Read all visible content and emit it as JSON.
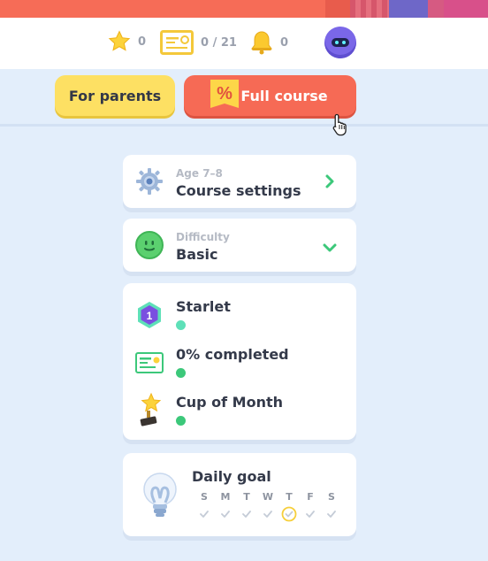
{
  "stats": {
    "stars": "0",
    "certificates": "0 / 21",
    "notifications": "0"
  },
  "nav": {
    "parents_label": "For parents",
    "full_course_label": "Full course",
    "full_course_badge": "%"
  },
  "course_settings": {
    "sub": "Age 7–8",
    "title": "Course settings"
  },
  "difficulty": {
    "sub": "Difficulty",
    "value": "Basic"
  },
  "progress": {
    "items": [
      {
        "label": "Starlet",
        "badge": "1",
        "status_color": "#5ee0b8"
      },
      {
        "label": "0% completed",
        "status_color": "#3cc87a"
      },
      {
        "label": "Cup of Month",
        "status_color": "#3cc87a"
      }
    ]
  },
  "daily_goal": {
    "title": "Daily goal",
    "days": [
      "S",
      "M",
      "T",
      "W",
      "T",
      "F",
      "S"
    ],
    "today_index": 4
  },
  "colors": {
    "accent_red": "#f66a55",
    "accent_yellow": "#fde063",
    "green": "#3cc87a",
    "background": "#e3eefb"
  },
  "icons": [
    "star-icon",
    "certificate-icon",
    "bell-icon",
    "avatar",
    "percent-icon",
    "gear-icon",
    "chevron-right-icon",
    "smiley-icon",
    "chevron-down-icon",
    "hexagon-badge-icon",
    "certificate-icon",
    "trophy-icon",
    "lightbulb-icon",
    "check-icon",
    "pointer-cursor-icon"
  ]
}
